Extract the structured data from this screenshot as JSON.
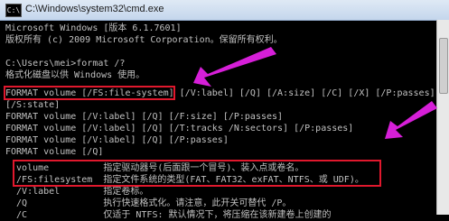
{
  "window": {
    "title": "C:\\Windows\\system32\\cmd.exe",
    "icon_text": "C:\\"
  },
  "console": {
    "lines": [
      "Microsoft Windows [版本 6.1.7601]",
      "版权所有 (c) 2009 Microsoft Corporation。保留所有权利。",
      "",
      "C:\\Users\\mei>format /?",
      "格式化磁盘以供 Windows 使用。",
      "",
      "FORMAT volume [/FS:file-system] [/V:label] [/Q] [/A:size] [/C] [/X] [/P:passes]",
      "[/S:state]",
      "FORMAT volume [/V:label] [/Q] [/F:size] [/P:passes]",
      "FORMAT volume [/V:label] [/Q] [/T:tracks /N:sectors] [/P:passes]",
      "FORMAT volume [/V:label] [/Q] [/P:passes]",
      "FORMAT volume [/Q]",
      "",
      "  volume          指定驱动器号(后面跟一个冒号)、装入点或卷名。",
      "  /FS:filesystem  指定文件系统的类型(FAT、FAT32、exFAT、NTFS、或 UDF)。",
      "  /V:label        指定卷标。",
      "  /Q              执行快速格式化。请注意，此开关可替代 /P。",
      "  /C              仅适于 NTFS: 默认情况下，将压缩在该新建卷上创建的"
    ]
  },
  "colors": {
    "console_bg": "#000000",
    "console_text": "#c0c0c0",
    "highlight": "#e0182d",
    "arrow": "#d61fd8"
  }
}
